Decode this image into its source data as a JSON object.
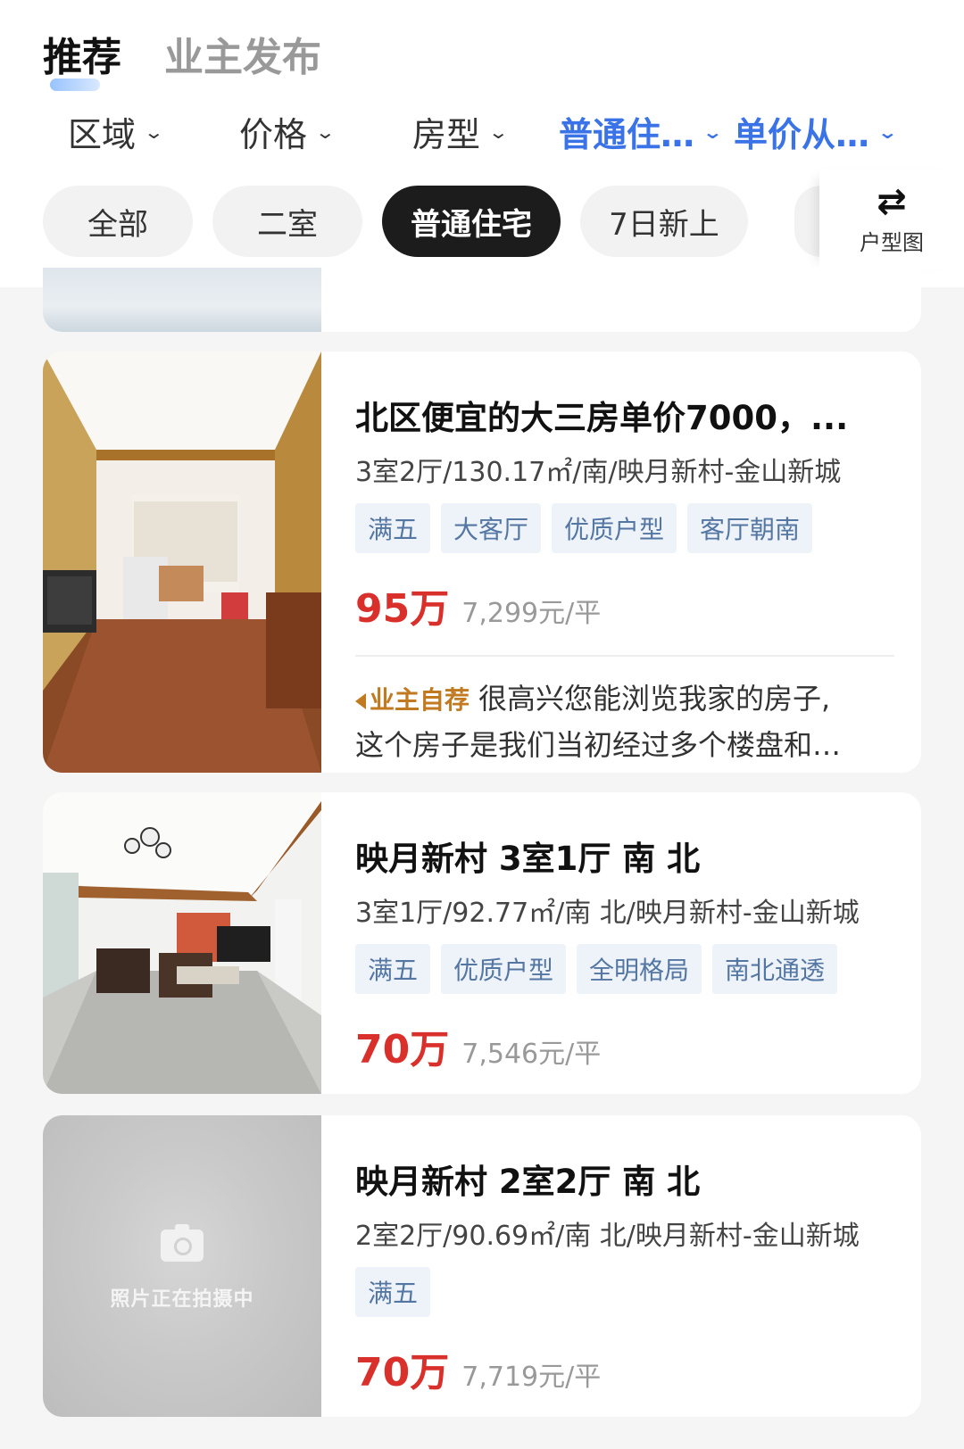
{
  "top_tabs": [
    {
      "label": "推荐",
      "active": true
    },
    {
      "label": "业主发布",
      "active": false
    }
  ],
  "filters": [
    {
      "label": "区域",
      "active": false
    },
    {
      "label": "价格",
      "active": false
    },
    {
      "label": "房型",
      "active": false
    },
    {
      "label": "普通住…",
      "active": true
    },
    {
      "label": "单价从…",
      "active": true
    }
  ],
  "chips": [
    {
      "label": "全部",
      "active": false
    },
    {
      "label": "二室",
      "active": false
    },
    {
      "label": "普通住宅",
      "active": true
    },
    {
      "label": "7日新上",
      "active": false
    }
  ],
  "floor_plan_button": {
    "icon": "swap-arrows-icon",
    "label": "户型图"
  },
  "listings": [
    {
      "title": "北区便宜的大三房单价7000，...",
      "meta": "3室2厅/130.17㎡/南/映月新村-金山新城",
      "tags": [
        "满五",
        "大客厅",
        "优质户型",
        "客厅朝南"
      ],
      "price": "95万",
      "unit_price": "7,299元/平",
      "owner_badge": "业主自荐",
      "owner_text_1": "很高兴您能浏览我家的房子,",
      "owner_text_2": "这个房子是我们当初经过多个楼盘和…"
    },
    {
      "title": "映月新村 3室1厅 南 北",
      "meta": "3室1厅/92.77㎡/南 北/映月新村-金山新城",
      "tags": [
        "满五",
        "优质户型",
        "全明格局",
        "南北通透"
      ],
      "price": "70万",
      "unit_price": "7,546元/平"
    },
    {
      "title": "映月新村 2室2厅 南 北",
      "meta": "2室2厅/90.69㎡/南 北/映月新村-金山新城",
      "tags": [
        "满五"
      ],
      "price": "70万",
      "unit_price": "7,719元/平",
      "placeholder_text": "照片正在拍摄中"
    }
  ],
  "colors": {
    "accent_blue": "#3a72e8",
    "price_red": "#d9302c",
    "tag_bg": "#eef3fa",
    "tag_text": "#5476a3",
    "owner_badge": "#c27a21"
  }
}
